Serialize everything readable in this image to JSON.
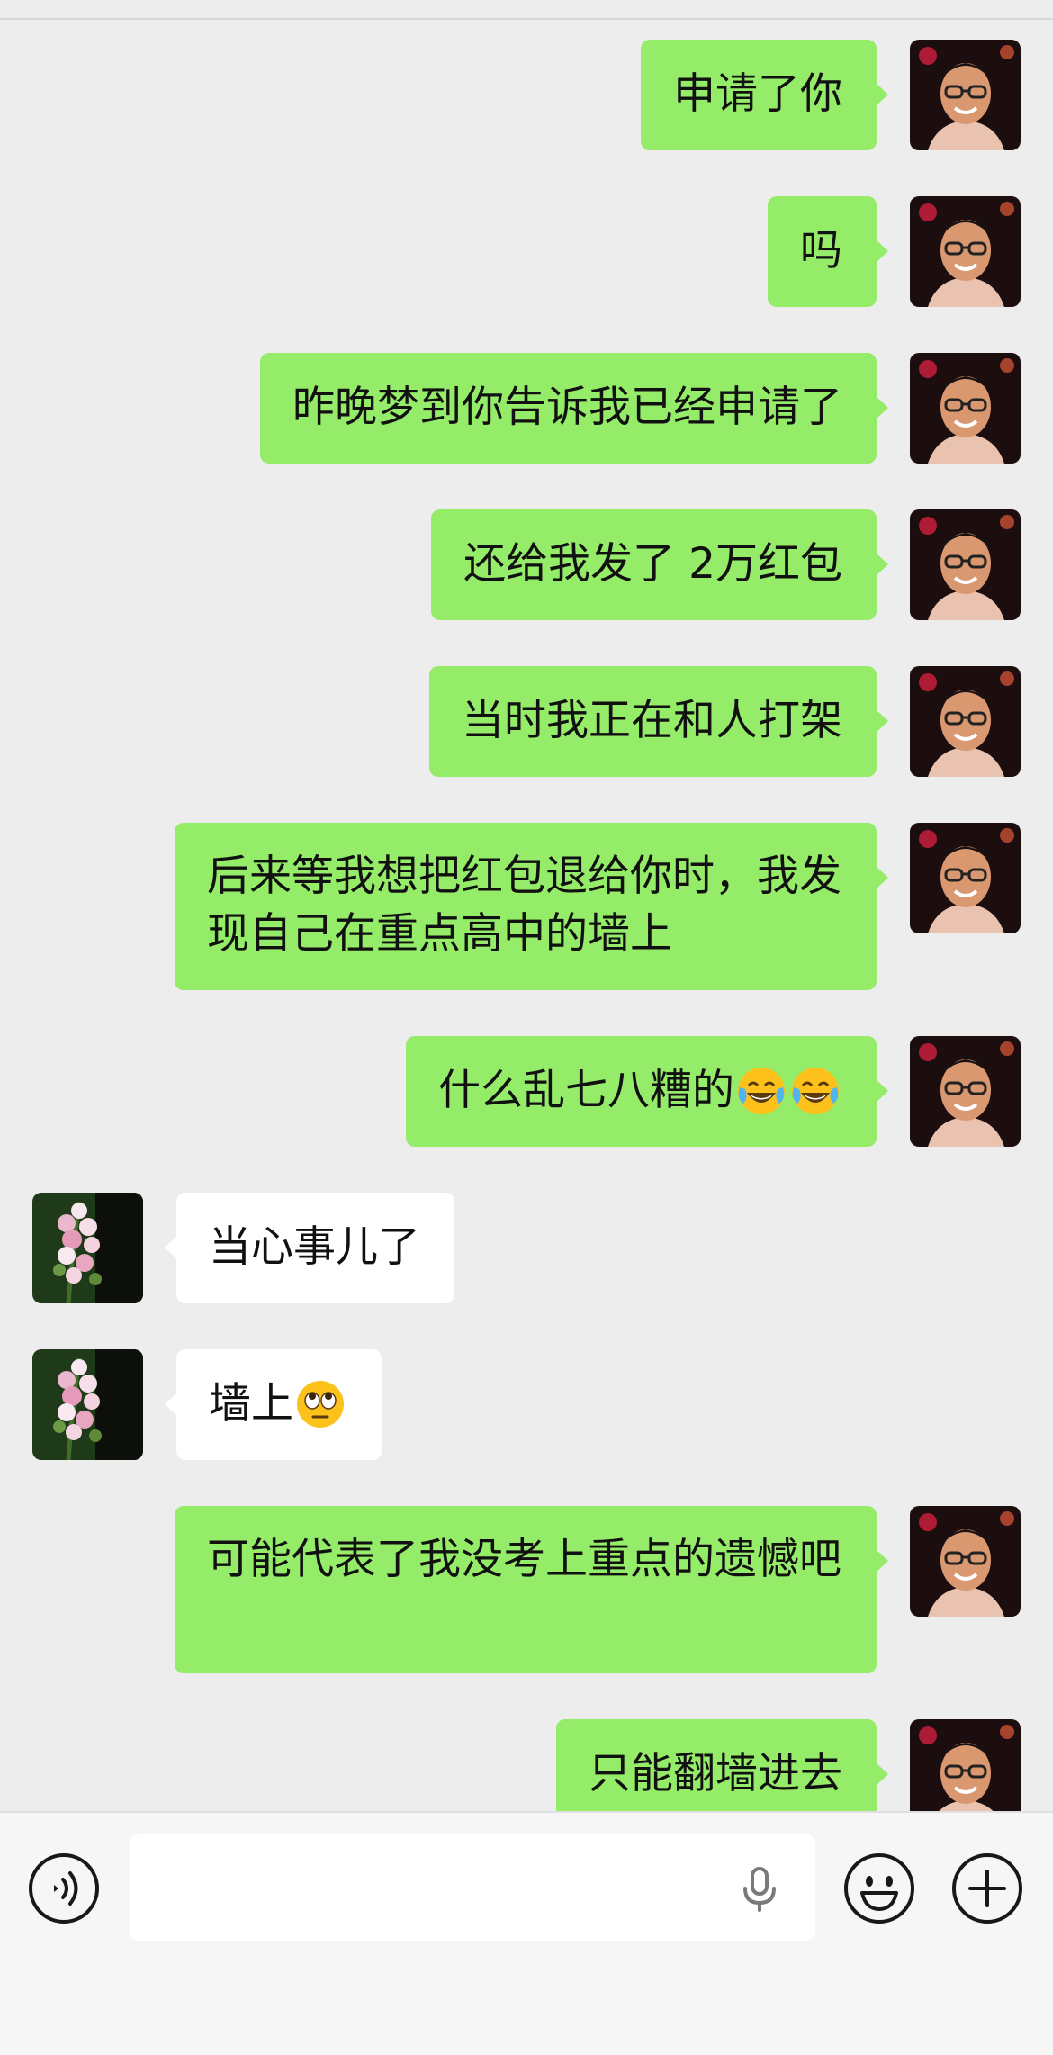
{
  "chat": {
    "messages": [
      {
        "sender": "me",
        "text": "申请了你"
      },
      {
        "sender": "me",
        "text": "吗"
      },
      {
        "sender": "me",
        "text": "昨晚梦到你告诉我已经申请了"
      },
      {
        "sender": "me",
        "text": "还给我发了 2万红包"
      },
      {
        "sender": "me",
        "text": "当时我正在和人打架"
      },
      {
        "sender": "me",
        "text": "后来等我想把红包退给你时，我发现自己在重点高中的墙上"
      },
      {
        "sender": "me",
        "text": "什么乱七八糟的",
        "emoji": [
          "tears-of-joy-emoji",
          "tears-of-joy-emoji"
        ]
      },
      {
        "sender": "other",
        "text": "当心事儿了"
      },
      {
        "sender": "other",
        "text": "墙上",
        "emoji": [
          "rolling-eyes-emoji"
        ]
      },
      {
        "sender": "me",
        "text": "可能代表了我没考上重点的遗憾吧"
      },
      {
        "sender": "me",
        "text": "只能翻墙进去"
      }
    ]
  },
  "input_bar": {
    "placeholder": "",
    "value": "",
    "icons": [
      "voice-icon",
      "microphone-icon",
      "emoji-smile-icon",
      "plus-icon"
    ]
  },
  "colors": {
    "background": "#ededed",
    "my_bubble": "#95ec69",
    "other_bubble": "#ffffff",
    "input_bar": "#f6f6f6"
  }
}
